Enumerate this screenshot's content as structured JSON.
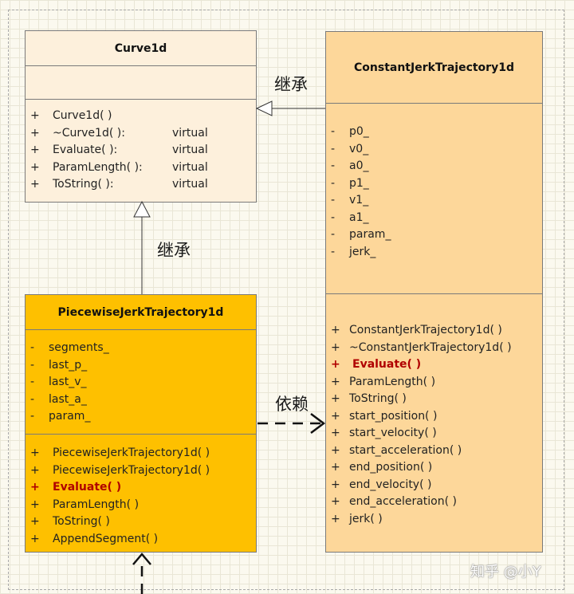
{
  "classes": {
    "curve1d": {
      "name": "Curve1d",
      "attributes": [],
      "operations": [
        {
          "vis": "+",
          "name": "Curve1d( )",
          "modifier": ""
        },
        {
          "vis": "+",
          "name": "~Curve1d( ):",
          "modifier": "virtual"
        },
        {
          "vis": "+",
          "name": "Evaluate( ):",
          "modifier": "virtual"
        },
        {
          "vis": "+",
          "name": "ParamLength( ):",
          "modifier": "virtual"
        },
        {
          "vis": "+",
          "name": "ToString( ):",
          "modifier": "virtual"
        }
      ]
    },
    "constant_jerk": {
      "name": "ConstantJerkTrajectory1d",
      "attributes": [
        {
          "vis": "-",
          "name": "p0_"
        },
        {
          "vis": "-",
          "name": "v0_"
        },
        {
          "vis": "-",
          "name": "a0_"
        },
        {
          "vis": "-",
          "name": "p1_"
        },
        {
          "vis": "-",
          "name": "v1_"
        },
        {
          "vis": "-",
          "name": "a1_"
        },
        {
          "vis": "-",
          "name": "param_"
        },
        {
          "vis": "-",
          "name": "jerk_"
        }
      ],
      "operations": [
        {
          "vis": "+",
          "name": "ConstantJerkTrajectory1d( )"
        },
        {
          "vis": "+",
          "name": "~ConstantJerkTrajectory1d( )"
        },
        {
          "vis": "+",
          "name": "Evaluate( )",
          "highlight": true
        },
        {
          "vis": "+",
          "name": "ParamLength( )"
        },
        {
          "vis": "+",
          "name": "ToString( )"
        },
        {
          "vis": "+",
          "name": "start_position( )"
        },
        {
          "vis": "+",
          "name": "start_velocity( )"
        },
        {
          "vis": "+",
          "name": "start_acceleration( )"
        },
        {
          "vis": "+",
          "name": "end_position( )"
        },
        {
          "vis": "+",
          "name": "end_velocity( )"
        },
        {
          "vis": "+",
          "name": "end_acceleration( )"
        },
        {
          "vis": "+",
          "name": "jerk( )"
        }
      ]
    },
    "piecewise_jerk": {
      "name": "PiecewiseJerkTrajectory1d",
      "attributes": [
        {
          "vis": "-",
          "name": "segments_"
        },
        {
          "vis": "-",
          "name": "last_p_"
        },
        {
          "vis": "-",
          "name": "last_v_"
        },
        {
          "vis": "-",
          "name": "last_a_"
        },
        {
          "vis": "-",
          "name": "param_"
        }
      ],
      "operations": [
        {
          "vis": "+",
          "name": "PiecewiseJerkTrajectory1d( )"
        },
        {
          "vis": "+",
          "name": "PiecewiseJerkTrajectory1d( )"
        },
        {
          "vis": "+",
          "name": "Evaluate( )",
          "highlight": true
        },
        {
          "vis": "+",
          "name": "ParamLength( )"
        },
        {
          "vis": "+",
          "name": "ToString( )"
        },
        {
          "vis": "+",
          "name": "AppendSegment( )"
        }
      ]
    }
  },
  "relations": {
    "inherit_right": "继承",
    "inherit_down": "继承",
    "dependency": "依赖"
  },
  "watermark": "知乎 @小Y",
  "colors": {
    "curve1d_fill": "#fdf0dc",
    "constant_jerk_fill": "#fdd79a",
    "piecewise_fill": "#fec000",
    "highlight": "#b00000"
  }
}
